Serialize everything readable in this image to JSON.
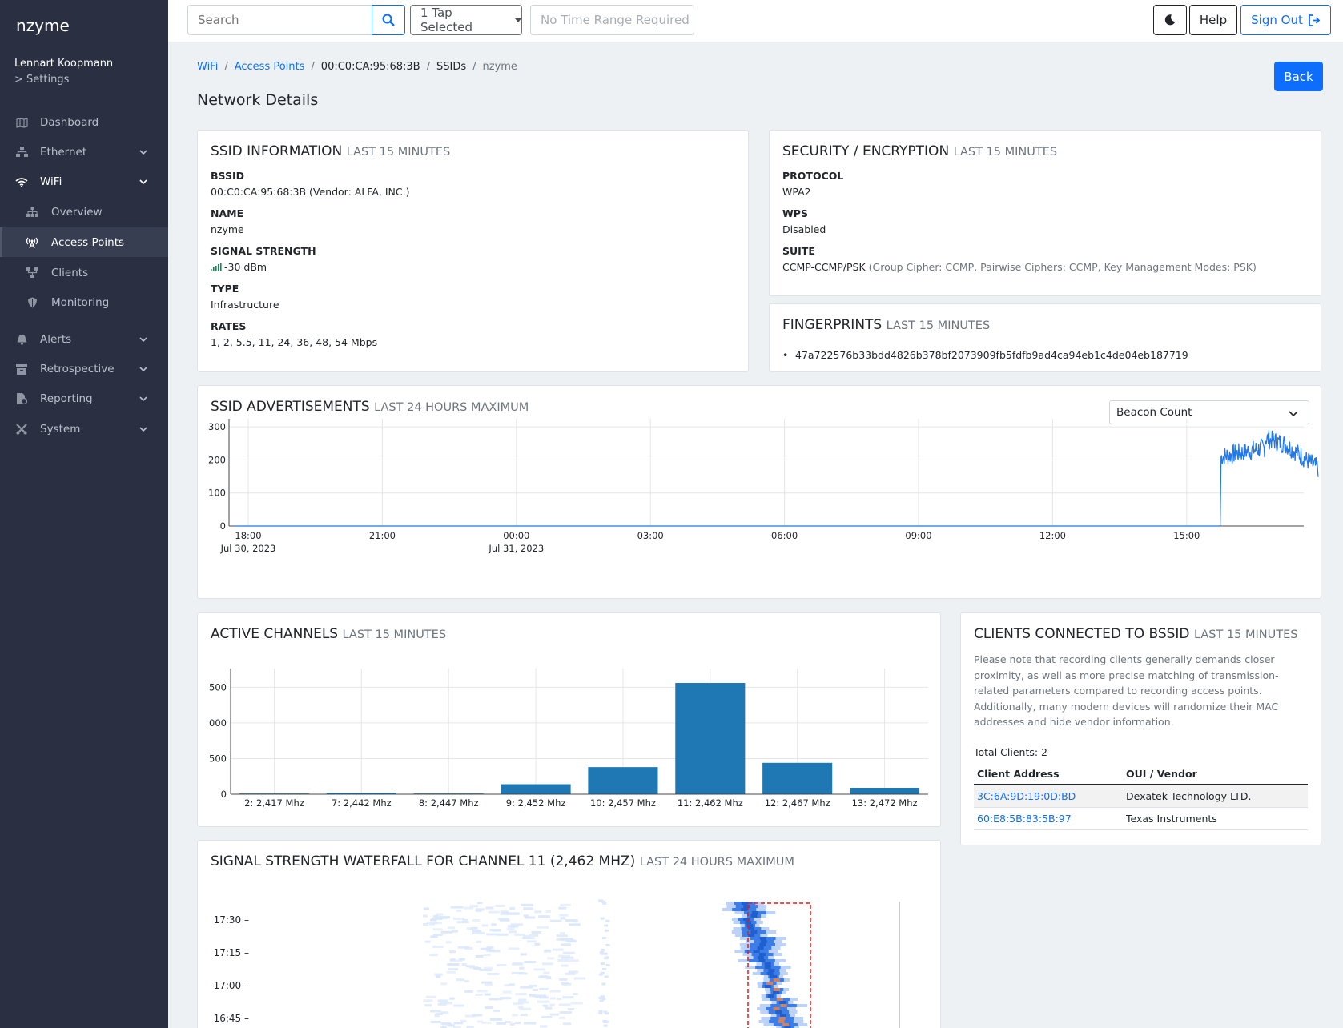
{
  "sidebar": {
    "brand": "nzyme",
    "user": "Lennart Koopmann",
    "settings": "> Settings",
    "items": [
      {
        "label": "Dashboard",
        "icon": "map-icon"
      },
      {
        "label": "Ethernet",
        "icon": "network-icon"
      },
      {
        "label": "WiFi",
        "icon": "wifi-icon"
      },
      {
        "label": "Overview",
        "icon": "sitemap-icon"
      },
      {
        "label": "Access Points",
        "icon": "antenna-icon"
      },
      {
        "label": "Clients",
        "icon": "clients-icon"
      },
      {
        "label": "Monitoring",
        "icon": "shield-icon"
      },
      {
        "label": "Alerts",
        "icon": "bell-icon"
      },
      {
        "label": "Retrospective",
        "icon": "archive-icon"
      },
      {
        "label": "Reporting",
        "icon": "report-icon"
      },
      {
        "label": "System",
        "icon": "tools-icon"
      }
    ]
  },
  "topbar": {
    "search_placeholder": "Search",
    "tap_selected": "1 Tap Selected",
    "time_range": "No Time Range Required",
    "help": "Help",
    "sign_out": "Sign Out"
  },
  "breadcrumb": [
    "WiFi",
    "Access Points",
    "00:C0:CA:95:68:3B",
    "SSIDs",
    "nzyme"
  ],
  "page_title": "Network Details",
  "back_label": "Back",
  "ssid_info": {
    "title": "SSID INFORMATION",
    "subtitle": "LAST 15 MINUTES",
    "bssid_label": "BSSID",
    "bssid_value": "00:C0:CA:95:68:3B (Vendor: ALFA, INC.)",
    "name_label": "NAME",
    "name_value": "nzyme",
    "signal_label": "SIGNAL STRENGTH",
    "signal_value": "-30 dBm",
    "type_label": "TYPE",
    "type_value": "Infrastructure",
    "rates_label": "RATES",
    "rates_value": "1, 2, 5.5, 11, 24, 36, 48, 54 Mbps"
  },
  "security": {
    "title": "SECURITY / ENCRYPTION",
    "subtitle": "LAST 15 MINUTES",
    "protocol_label": "PROTOCOL",
    "protocol_value": "WPA2",
    "wps_label": "WPS",
    "wps_value": "Disabled",
    "suite_label": "SUITE",
    "suite_value": "CCMP-CCMP/PSK",
    "suite_detail": "(Group Cipher: CCMP, Pairwise Ciphers: CCMP, Key Management Modes: PSK)"
  },
  "fingerprints": {
    "title": "FINGERPRINTS",
    "subtitle": "LAST 15 MINUTES",
    "items": [
      "47a722576b33bdd4826b378bf2073909fb5fdfb9ad4ca94eb1c4de04eb187719"
    ]
  },
  "advertisements": {
    "title": "SSID ADVERTISEMENTS",
    "subtitle": "LAST 24 HOURS MAXIMUM",
    "select_value": "Beacon Count"
  },
  "channels": {
    "title": "ACTIVE CHANNELS",
    "subtitle": "LAST 15 MINUTES"
  },
  "clients": {
    "title": "CLIENTS CONNECTED TO BSSID",
    "subtitle": "LAST 15 MINUTES",
    "note": "Please note that recording clients generally demands closer proximity, as well as more precise matching of transmission-related parameters compared to recording access points. Additionally, many modern devices will randomize their MAC addresses and hide vendor information.",
    "total": "Total Clients: 2",
    "columns": [
      "Client Address",
      "OUI / Vendor"
    ],
    "rows": [
      {
        "address": "3C:6A:9D:19:0D:BD",
        "vendor": "Dexatek Technology LTD."
      },
      {
        "address": "60:E8:5B:83:5B:97",
        "vendor": "Texas Instruments"
      }
    ]
  },
  "waterfall": {
    "title": "SIGNAL STRENGTH WATERFALL FOR CHANNEL 11 (2,462 MHZ)",
    "subtitle": "LAST 24 HOURS MAXIMUM",
    "y_ticks": [
      "17:30",
      "17:15",
      "17:00",
      "16:45"
    ]
  },
  "chart_data": [
    {
      "type": "line",
      "title": "SSID ADVERTISEMENTS",
      "x_ticks": [
        "18:00",
        "21:00",
        "00:00",
        "03:00",
        "06:00",
        "09:00",
        "12:00",
        "15:00"
      ],
      "x_subticks": [
        "Jul 30, 2023",
        "",
        "Jul 31, 2023",
        "",
        "",
        "",
        "",
        ""
      ],
      "y_ticks": [
        0,
        100,
        200,
        300
      ],
      "ylim": [
        0,
        310
      ],
      "series": [
        {
          "values_note_hours_from_1800": [
            0,
            21.7,
            21.75
          ],
          "x": [
            "Jul 30, 2023 18:00",
            "Jul 31, 2023 15:45",
            "Jul 31, 2023 15:50",
            "Jul 31, 2023 16:30",
            "Jul 31, 2023 17:00",
            "Jul 31, 2023 17:30",
            "Jul 31, 2023 17:55"
          ],
          "y": [
            0,
            0,
            210,
            240,
            270,
            230,
            160
          ]
        }
      ],
      "color": "#1f77e8"
    },
    {
      "type": "bar",
      "title": "ACTIVE CHANNELS",
      "categories": [
        "2: 2,417 Mhz",
        "7: 2,442 Mhz",
        "8: 2,447 Mhz",
        "9: 2,452 Mhz",
        "10: 2,457 Mhz",
        "11: 2,462 Mhz",
        "12: 2,467 Mhz",
        "13: 2,472 Mhz"
      ],
      "values": [
        10,
        20,
        10,
        140,
        380,
        1560,
        440,
        90
      ],
      "y_ticks": [
        "0",
        "500",
        "000",
        "500"
      ],
      "ylim": [
        0,
        1650
      ],
      "color": "#1f77b4"
    }
  ]
}
